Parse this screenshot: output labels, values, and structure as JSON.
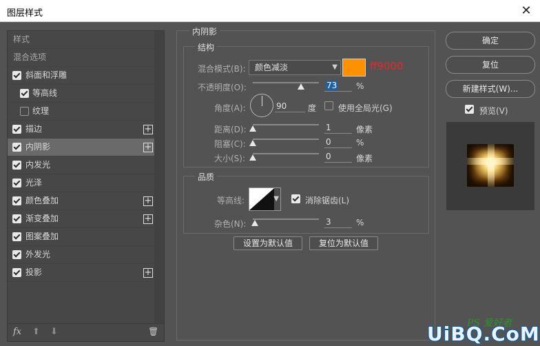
{
  "window": {
    "title": "图层样式",
    "close": "✕"
  },
  "styles_list": {
    "items": [
      {
        "label": "样式",
        "type": "header"
      },
      {
        "label": "混合选项",
        "type": "header"
      },
      {
        "label": "斜面和浮雕",
        "checked": true,
        "indent": 0,
        "plus": false
      },
      {
        "label": "等高线",
        "checked": true,
        "indent": 1,
        "plus": false
      },
      {
        "label": "纹理",
        "checked": false,
        "indent": 1,
        "plus": false
      },
      {
        "label": "描边",
        "checked": true,
        "indent": 0,
        "plus": true
      },
      {
        "label": "内阴影",
        "checked": true,
        "indent": 0,
        "plus": true,
        "selected": true
      },
      {
        "label": "内发光",
        "checked": true,
        "indent": 0,
        "plus": false
      },
      {
        "label": "光泽",
        "checked": true,
        "indent": 0,
        "plus": false
      },
      {
        "label": "颜色叠加",
        "checked": true,
        "indent": 0,
        "plus": true
      },
      {
        "label": "渐变叠加",
        "checked": true,
        "indent": 0,
        "plus": true
      },
      {
        "label": "图案叠加",
        "checked": true,
        "indent": 0,
        "plus": false
      },
      {
        "label": "外发光",
        "checked": true,
        "indent": 0,
        "plus": false
      },
      {
        "label": "投影",
        "checked": true,
        "indent": 0,
        "plus": true
      }
    ],
    "footer": {
      "fx": "fx",
      "up": "⬆",
      "down": "⬇",
      "trash": "🗑"
    }
  },
  "inner_shadow": {
    "title": "内阴影",
    "structure": {
      "title": "结构",
      "blend_mode_label": "混合模式(B):",
      "blend_mode_value": "颜色减淡",
      "color": "#ff9000",
      "color_label": "ff9000",
      "opacity_label": "不透明度(O):",
      "opacity_value": "73",
      "opacity_unit": "%",
      "opacity_fraction": 0.73,
      "angle_label": "角度(A):",
      "angle_value": "90",
      "angle_unit": "度",
      "global_light_label": "使用全局光(G)",
      "global_light_checked": false,
      "distance_label": "距离(D):",
      "distance_value": "1",
      "distance_unit": "像素",
      "choke_label": "阻塞(C):",
      "choke_value": "0",
      "choke_unit": "%",
      "size_label": "大小(S):",
      "size_value": "0",
      "size_unit": "像素"
    },
    "quality": {
      "title": "品质",
      "contour_label": "等高线:",
      "anti_alias_label": "消除锯齿(L)",
      "anti_alias_checked": true,
      "noise_label": "杂色(N):",
      "noise_value": "3",
      "noise_unit": "%"
    },
    "make_default": "设置为默认值",
    "reset_default": "复位为默认值"
  },
  "actions": {
    "ok": "确定",
    "reset": "复位",
    "new_style": "新建样式(W)...",
    "preview_label": "预览(V)",
    "preview_checked": true
  },
  "watermark": {
    "ps": "PS 爱好者",
    "brand": "UiBQ.CoM"
  }
}
